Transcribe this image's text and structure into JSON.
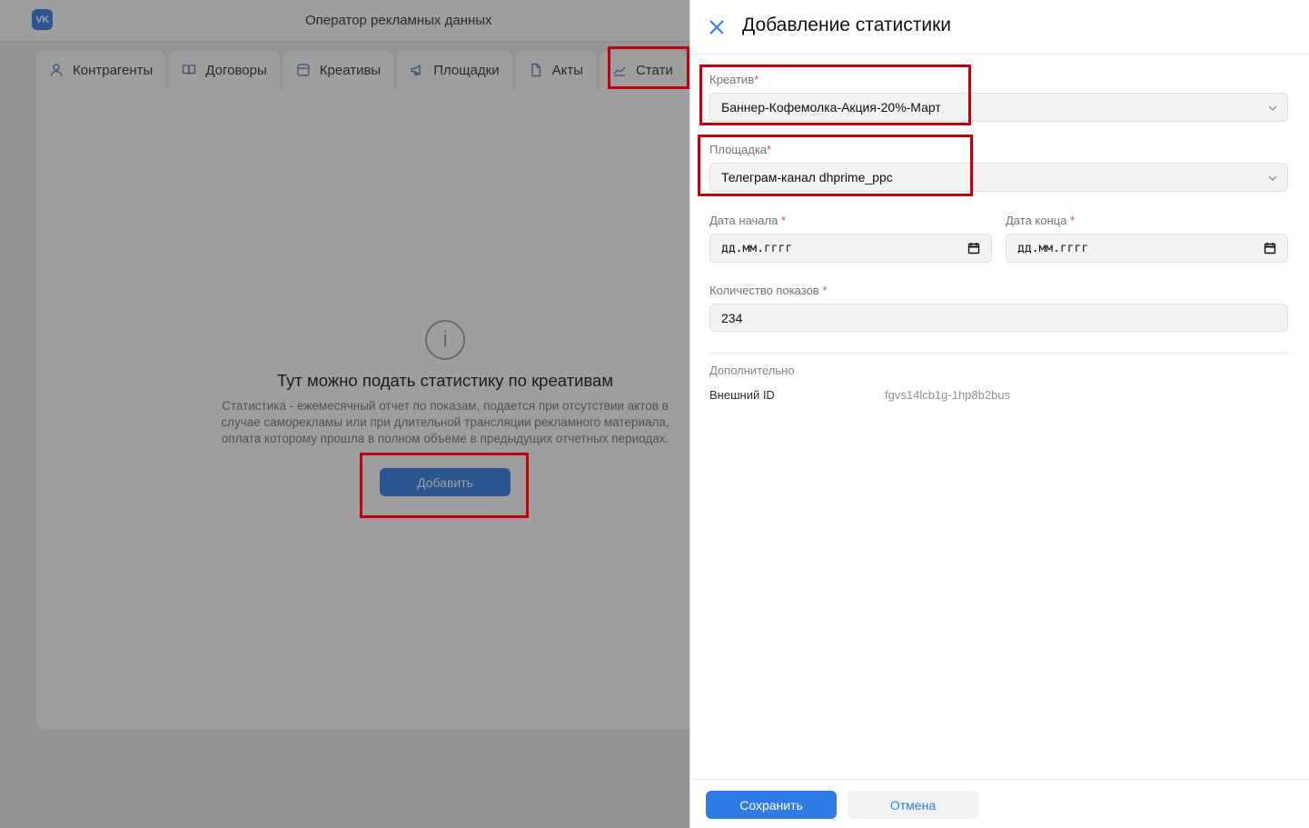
{
  "app": {
    "logo_text": "VK",
    "title": "Оператор рекламных данных"
  },
  "tabs": [
    {
      "label": "Контрагенты",
      "icon": "person-icon"
    },
    {
      "label": "Договоры",
      "icon": "book-icon"
    },
    {
      "label": "Креативы",
      "icon": "creative-icon"
    },
    {
      "label": "Площадки",
      "icon": "megaphone-icon"
    },
    {
      "label": "Акты",
      "icon": "document-icon"
    },
    {
      "label": "Стати",
      "icon": "chart-line-icon"
    }
  ],
  "empty_state": {
    "icon": "info-icon",
    "info_glyph": "i",
    "title": "Тут можно подать статистику по креативам",
    "description": "Статистика - ежемесячный отчет по показам, подается при отсутствии актов в случае саморекламы или при длительной трансляции рекламного материала, оплата которому прошла в полном объеме в предыдущих отчетных периодах.",
    "add_label": "Добавить"
  },
  "panel": {
    "title": "Добавление статистики",
    "creative": {
      "label": "Креатив",
      "required_mark": "*",
      "value": "Баннер-Кофемолка-Акция-20%-Март"
    },
    "platform": {
      "label": "Площадка",
      "required_mark": "*",
      "value": "Телеграм-канал dhprime_ppc"
    },
    "date_start": {
      "label": "Дата начала",
      "required_mark": "*",
      "placeholder": "дд.мм.гггг"
    },
    "date_end": {
      "label": "Дата конца",
      "required_mark": "*",
      "placeholder": "дд.мм.гггг"
    },
    "impressions": {
      "label": "Количество показов",
      "required_mark": "*",
      "value": "234"
    },
    "extra": {
      "section_title": "Дополнительно",
      "external_id_label": "Внешний ID",
      "external_id_value": "fgvs14lcb1g-1hp8b2bus"
    },
    "save_label": "Сохранить",
    "cancel_label": "Отмена"
  },
  "colors": {
    "accent": "#2f7be5",
    "highlight": "#c0000d",
    "required": "#e64646"
  }
}
